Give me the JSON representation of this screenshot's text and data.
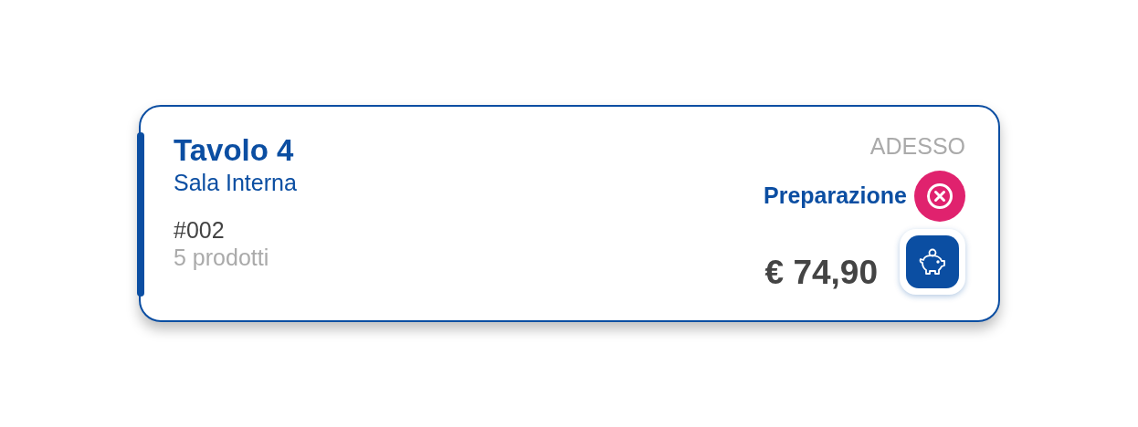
{
  "order": {
    "table": "Tavolo 4",
    "room": "Sala Interna",
    "number": "#002",
    "items": "5 prodotti",
    "time": "ADESSO",
    "status": "Preparazione",
    "total": "€ 74,90"
  }
}
